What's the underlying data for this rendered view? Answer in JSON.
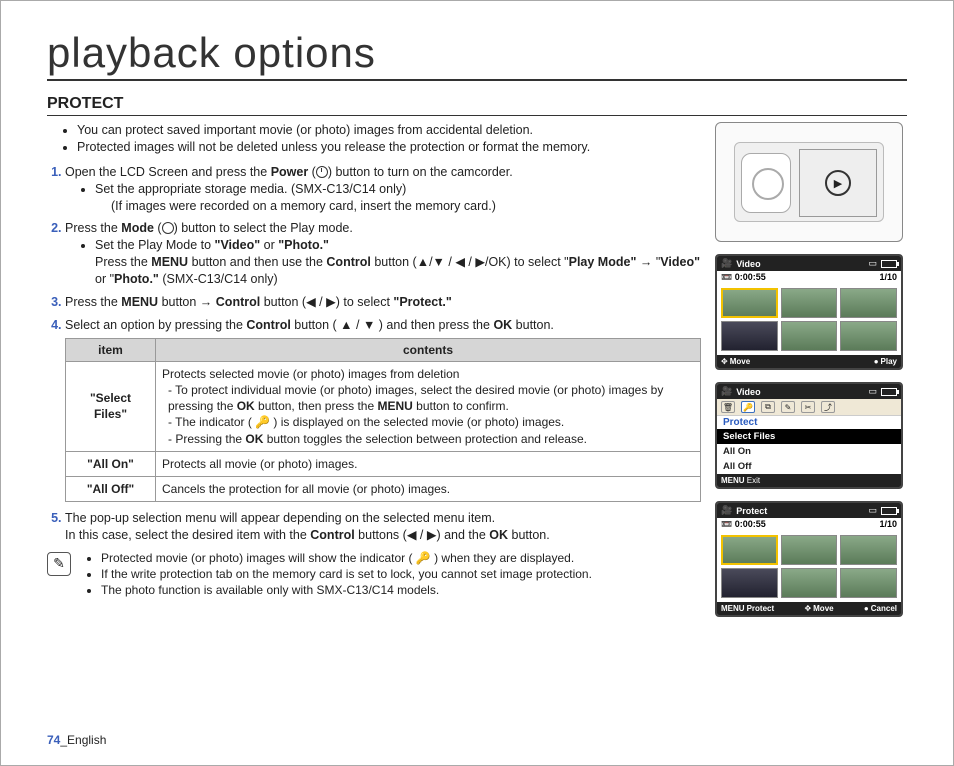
{
  "title": "playback options",
  "section": "PROTECT",
  "intro": [
    "You can protect saved important movie (or photo) images from accidental deletion.",
    "Protected images will not be deleted unless you release the protection or format the memory."
  ],
  "steps": {
    "s1_pre": "Open the LCD Screen and press the ",
    "s1_bold": "Power",
    "s1_post": " button to turn on the camcorder.",
    "s1_sub1": "Set the appropriate storage media. (SMX-C13/C14 only)",
    "s1_sub1b": "(If images were recorded on a memory card, insert the memory card.)",
    "s2_pre": "Press the ",
    "s2_bold": "Mode",
    "s2_post": " button to select the Play mode.",
    "s2_sub1_pre": "Set the Play Mode to ",
    "s2_sub1_a": "\"Video\"",
    "s2_sub1_mid": " or ",
    "s2_sub1_b": "\"Photo.\"",
    "s2_sub2_pre": "Press the ",
    "s2_sub2_menu": "MENU",
    "s2_sub2_mid": " button and then use the ",
    "s2_sub2_ctrl": "Control",
    "s2_sub2_post": " button (▲/▼ / ◀ / ▶/OK) to select \"",
    "s2_sub2_play": "Play Mode\"",
    "s2_sub2_arrow": " → \"",
    "s2_sub2_vid": "Video\"",
    "s2_sub2_or": " or \"",
    "s2_sub2_photo": "Photo.\"",
    "s2_sub2_end": " (SMX-C13/C14 only)",
    "s3_pre": "Press the ",
    "s3_menu": "MENU",
    "s3_mid": " button → ",
    "s3_ctrl": "Control",
    "s3_post": " button (◀ / ▶) to select ",
    "s3_protect": "\"Protect.\"",
    "s4_pre": "Select an option by pressing the ",
    "s4_ctrl": "Control",
    "s4_mid": " button ( ▲ / ▼ ) and then press the ",
    "s4_ok": "OK",
    "s4_post": " button.",
    "s5_pre": "The pop-up selection menu will appear depending on the selected menu item.",
    "s5_line2_pre": "In this case, select the desired item with the ",
    "s5_ctrl": "Control",
    "s5_mid": " buttons (◀ / ▶) and the ",
    "s5_ok": "OK",
    "s5_post": " button."
  },
  "table": {
    "h_item": "item",
    "h_contents": "contents",
    "r1_item": "\"Select Files\"",
    "r1_intro": "Protects selected movie (or photo) images from deletion",
    "r1_a_pre": "To protect individual movie (or photo) images, select the desired movie (or photo) images by pressing the ",
    "r1_a_ok": "OK",
    "r1_a_mid": " button, then press the ",
    "r1_a_menu": "MENU",
    "r1_a_post": " button to confirm.",
    "r1_b": "The indicator ( 🔑 ) is displayed on the selected movie (or photo) images.",
    "r1_c_pre": "Pressing the ",
    "r1_c_ok": "OK",
    "r1_c_post": " button toggles the selection between protection and release.",
    "r2_item": "\"All On\"",
    "r2_c": "Protects all movie (or photo) images.",
    "r3_item": "\"All Off\"",
    "r3_c": "Cancels the protection for all movie (or photo) images."
  },
  "notes": [
    "Protected movie (or photo) images will show the indicator ( 🔑 ) when they are displayed.",
    "If the write protection tab on the memory card is set to lock, you cannot set image protection.",
    "The photo function is available only with SMX-C13/C14 models."
  ],
  "footer": {
    "page": "74",
    "lang": "_English"
  },
  "lcd": {
    "video_label": "Video",
    "time": "0:00:55",
    "counter": "1/10",
    "move": "Move",
    "play": "Play",
    "protect_title": "Protect",
    "menu_select": "Select Files",
    "menu_on": "All On",
    "menu_off": "All Off",
    "exit": "Exit",
    "protect_bar": "Protect",
    "protect_btn": "Protect",
    "cancel": "Cancel",
    "menu_label": "MENU"
  }
}
